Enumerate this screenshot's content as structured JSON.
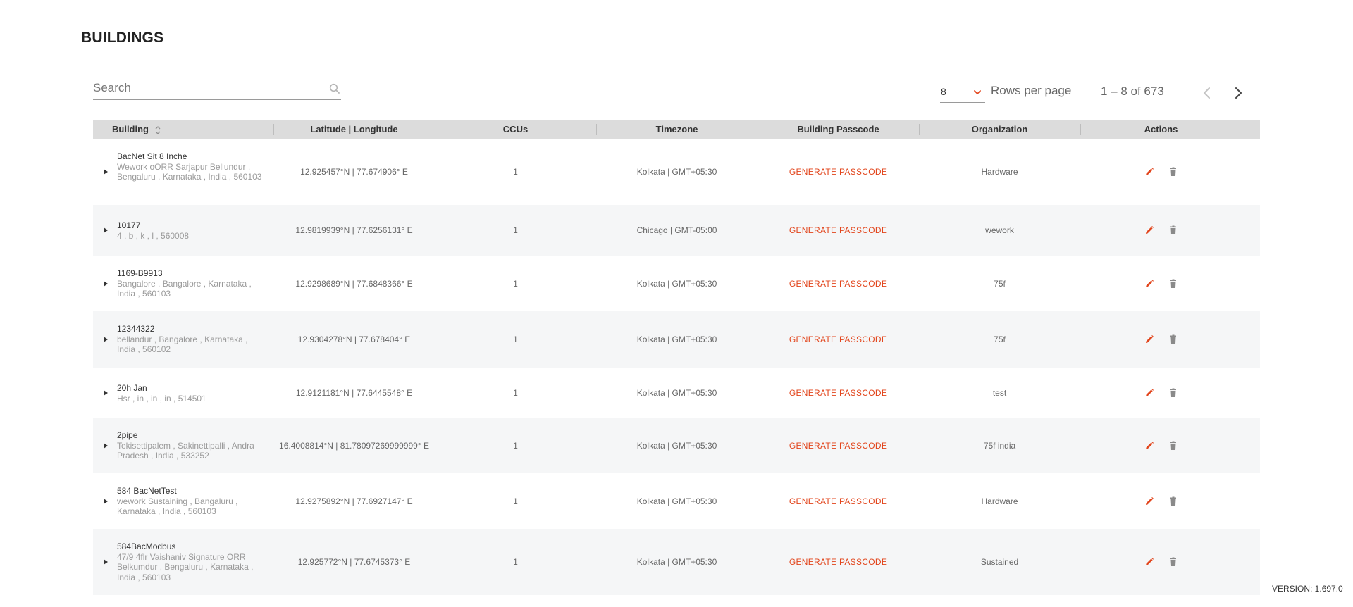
{
  "page": {
    "title": "BUILDINGS",
    "version": "VERSION: 1.697.0"
  },
  "search": {
    "placeholder": "Search",
    "value": "",
    "icon": "search-icon"
  },
  "pagination": {
    "rows_per_page_value": "8",
    "rows_per_page_label": "Rows per page",
    "range": "1 – 8 of 673"
  },
  "table": {
    "columns": [
      {
        "key": "building",
        "label": "Building"
      },
      {
        "key": "latlng",
        "label": "Latitude | Longitude"
      },
      {
        "key": "ccus",
        "label": "CCUs"
      },
      {
        "key": "timezone",
        "label": "Timezone"
      },
      {
        "key": "passcode",
        "label": "Building Passcode"
      },
      {
        "key": "organization",
        "label": "Organization"
      },
      {
        "key": "actions",
        "label": "Actions"
      }
    ],
    "rows": [
      {
        "name": "BacNet Sit 8 Inche",
        "address": "Wework oORR Sarjapur Bellundur , Bengaluru , Karnataka , India , 560103",
        "latlng": "12.925457°N | 77.674906° E",
        "ccus": "1",
        "timezone": "Kolkata | GMT+05:30",
        "passcode": "GENERATE PASSCODE",
        "organization": "Hardware"
      },
      {
        "name": "10177",
        "address": "4 , b , k , l , 560008",
        "latlng": "12.9819939°N | 77.6256131° E",
        "ccus": "1",
        "timezone": "Chicago | GMT-05:00",
        "passcode": "GENERATE PASSCODE",
        "organization": "wework"
      },
      {
        "name": "1169-B9913",
        "address": "Bangalore , Bangalore , Karnataka , India , 560103",
        "latlng": "12.9298689°N | 77.6848366° E",
        "ccus": "1",
        "timezone": "Kolkata | GMT+05:30",
        "passcode": "GENERATE PASSCODE",
        "organization": "75f"
      },
      {
        "name": "12344322",
        "address": "bellandur , Bangalore , Karnataka , India , 560102",
        "latlng": "12.9304278°N | 77.678404° E",
        "ccus": "1",
        "timezone": "Kolkata | GMT+05:30",
        "passcode": "GENERATE PASSCODE",
        "organization": "75f"
      },
      {
        "name": "20h Jan",
        "address": "Hsr , in , in , in , 514501",
        "latlng": "12.9121181°N | 77.6445548° E",
        "ccus": "1",
        "timezone": "Kolkata | GMT+05:30",
        "passcode": "GENERATE PASSCODE",
        "organization": "test"
      },
      {
        "name": "2pipe",
        "address": "Tekisettipalem , Sakinettipalli , Andra Pradesh , India , 533252",
        "latlng": "16.4008814°N | 81.78097269999999° E",
        "ccus": "1",
        "timezone": "Kolkata | GMT+05:30",
        "passcode": "GENERATE PASSCODE",
        "organization": "75f india"
      },
      {
        "name": "584 BacNetTest",
        "address": "wework Sustaining , Bangaluru , Karnataka , India , 560103",
        "latlng": "12.9275892°N | 77.6927147° E",
        "ccus": "1",
        "timezone": "Kolkata | GMT+05:30",
        "passcode": "GENERATE PASSCODE",
        "organization": "Hardware"
      },
      {
        "name": "584BacModbus",
        "address": "47/9 4flr Vaishaniv Signature ORR Belkumdur , Bengaluru , Karnataka , India , 560103",
        "latlng": "12.925772°N | 77.6745373° E",
        "ccus": "1",
        "timezone": "Kolkata | GMT+05:30",
        "passcode": "GENERATE PASSCODE",
        "organization": "Sustained"
      }
    ]
  },
  "colors": {
    "accent": "#e2451c",
    "header_bg": "#dcdcdc",
    "alt_row_bg": "#f5f6f7",
    "delete_icon": "#8a8a8a"
  }
}
